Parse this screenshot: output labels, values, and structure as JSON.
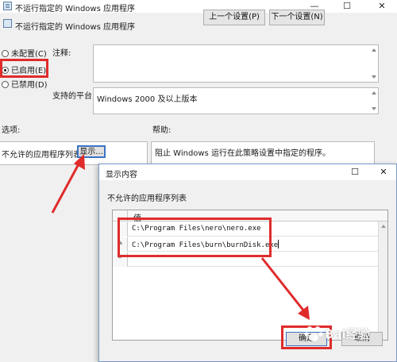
{
  "main_window": {
    "title": "不运行指定的 Windows 应用程序",
    "minimize": "—",
    "maximize": "☐",
    "close": "✕"
  },
  "policy": {
    "name": "不运行指定的 Windows 应用程序",
    "prev_label": "上一个设置(P)",
    "next_label": "下一个设置(N)"
  },
  "state": {
    "not_configured": "未配置(C)",
    "enabled": "已启用(E)",
    "disabled": "已禁用(D)",
    "selected": "enabled"
  },
  "comment": {
    "label": "注释:",
    "value": ""
  },
  "platform": {
    "label": "支持的平台:",
    "value": "Windows 2000 及以上版本"
  },
  "options": {
    "label": "选项:",
    "list_label": "不允许的应用程序列表",
    "show_button": "显示..."
  },
  "help": {
    "label": "帮助:",
    "text": "阻止 Windows 运行在此策略设置中指定的程序。"
  },
  "dialog": {
    "title": "显示内容",
    "maximize": "☐",
    "close": "✕",
    "list_label": "不允许的应用程序列表",
    "column": "值",
    "rows": [
      {
        "marker": "",
        "value": "C:\\Program Files\\nero\\nero.exe"
      },
      {
        "marker": "✎",
        "value": "C:\\Program Files\\burn\\burnDisk.exe"
      },
      {
        "marker": "*",
        "value": ""
      }
    ],
    "ok": "确定",
    "cancel": "取消"
  },
  "annotation_color": "#e02b2b",
  "watermark": "Bai经验"
}
